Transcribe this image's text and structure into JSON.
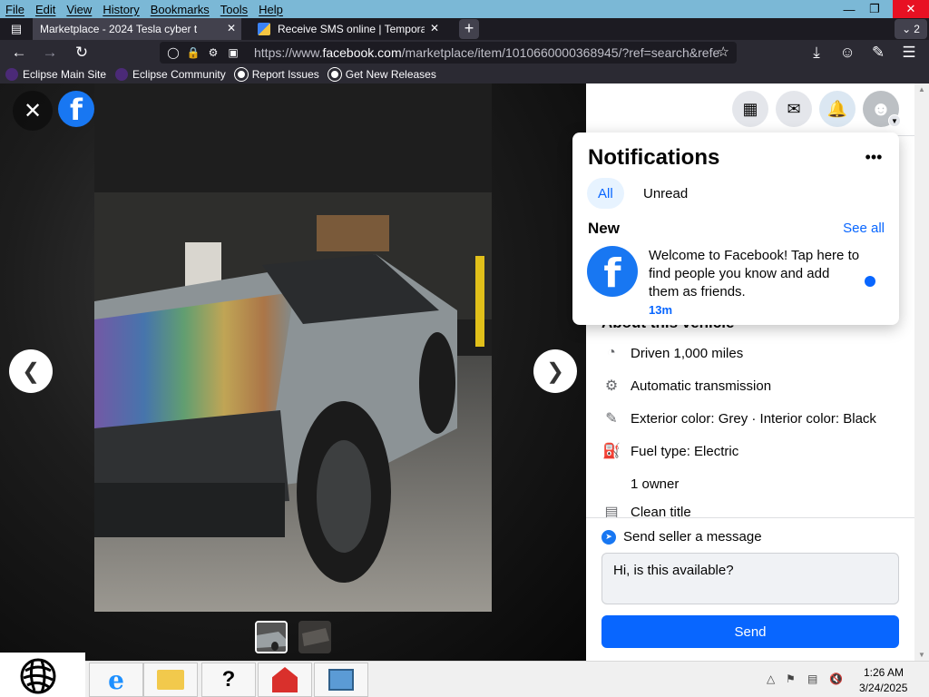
{
  "menubar": {
    "items": [
      "File",
      "Edit",
      "View",
      "History",
      "Bookmarks",
      "Tools",
      "Help"
    ]
  },
  "tabs": [
    {
      "title": "Marketplace - 2024 Tesla cyber t",
      "active": true
    },
    {
      "title": "Receive SMS online | Temporary",
      "active": false
    }
  ],
  "tab_count": "2",
  "url": {
    "prefix": "https://www.",
    "domain": "facebook.com",
    "path": "/marketplace/item/1010660000368945/?ref=search&refe"
  },
  "bookmarks": [
    "Eclipse Main Site",
    "Eclipse Community",
    "Report Issues",
    "Get New Releases"
  ],
  "viewer": {
    "thumbnails": [
      "thumb-1",
      "thumb-2"
    ]
  },
  "notifications": {
    "title": "Notifications",
    "filters": [
      "All",
      "Unread"
    ],
    "section_label": "New",
    "see_all": "See all",
    "items": [
      {
        "text": "Welcome to Facebook! Tap here to find people you know and add them as friends.",
        "time": "13m",
        "unread": true
      }
    ]
  },
  "listing": {
    "about_heading": "About this vehicle",
    "specs": [
      {
        "icon": "gauge-icon",
        "text": "Driven 1,000 miles"
      },
      {
        "icon": "engine-icon",
        "text": "Automatic transmission"
      },
      {
        "icon": "paint-icon",
        "text": "Exterior color: Grey · Interior color: Black"
      },
      {
        "icon": "fuel-icon",
        "text": "Fuel type: Electric"
      },
      {
        "icon": "",
        "text": "1 owner"
      },
      {
        "icon": "title-icon",
        "text": "Clean title"
      }
    ]
  },
  "message": {
    "label": "Send seller a message",
    "input_value": "Hi, is this available?",
    "send_label": "Send"
  },
  "taskbar": {
    "time": "1:26 AM",
    "date": "3/24/2025"
  },
  "colors": {
    "facebook_blue": "#0866ff",
    "titlebar": "#7bb8d6",
    "close_red": "#e81123"
  }
}
